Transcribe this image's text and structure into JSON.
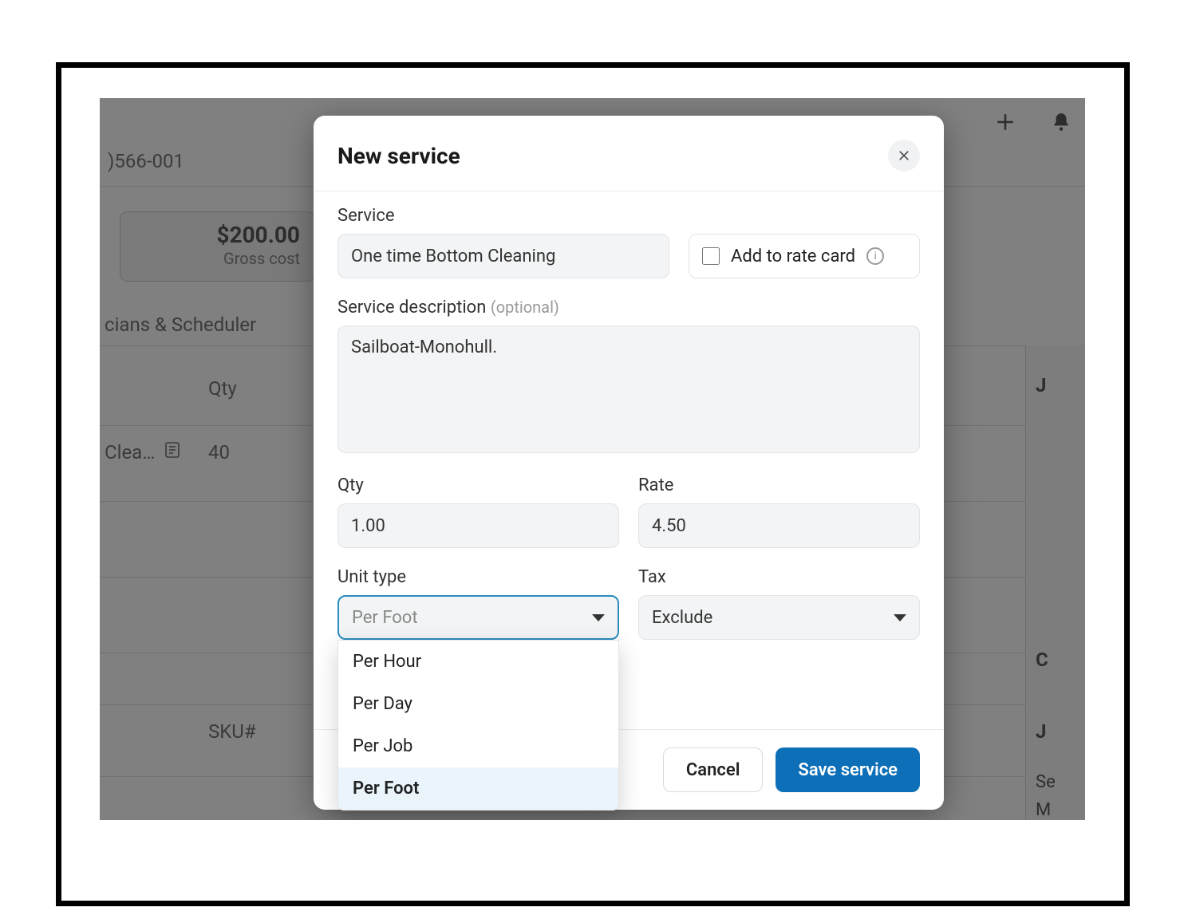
{
  "background": {
    "order_id_fragment": ")566-001",
    "amount": "$200.00",
    "amount_sublabel": "Gross cost",
    "tab_fragment": "cians & Scheduler",
    "qty_header": "Qty",
    "item_name_fragment": "Clea…",
    "item_qty": "40",
    "sku_header": "SKU#",
    "right_peek_j1": "J",
    "right_peek_c": "C",
    "right_peek_j2": "J",
    "right_peek_se": "Se",
    "right_peek_m": "M"
  },
  "modal": {
    "title": "New service",
    "service": {
      "label": "Service",
      "value": "One time Bottom Cleaning",
      "rate_card_label": "Add to rate card"
    },
    "description": {
      "label": "Service description",
      "optional": "(optional)",
      "value": "Sailboat-Monohull."
    },
    "qty": {
      "label": "Qty",
      "value": "1.00"
    },
    "rate": {
      "label": "Rate",
      "value": "4.50"
    },
    "unit_type": {
      "label": "Unit type",
      "placeholder": "Per Foot",
      "options": [
        "Per Hour",
        "Per Day",
        "Per Job",
        "Per Foot"
      ],
      "selected": "Per Foot"
    },
    "tax": {
      "label": "Tax",
      "value": "Exclude"
    },
    "cancel_label": "Cancel",
    "save_label": "Save service"
  }
}
